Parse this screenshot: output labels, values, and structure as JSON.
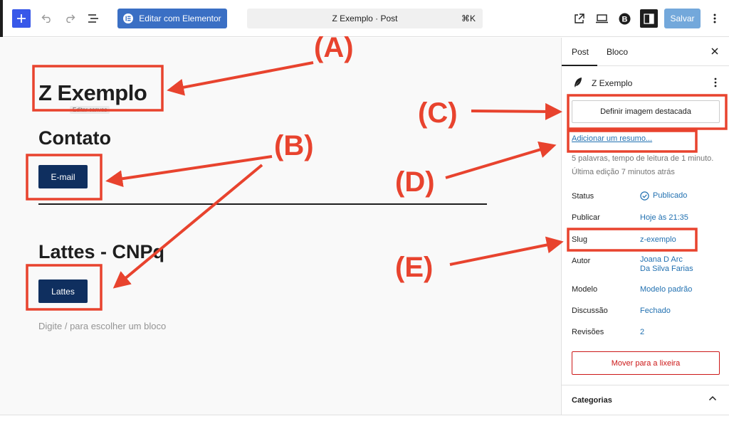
{
  "toolbar": {
    "elementor_label": "Editar com Elementor",
    "command_title": "Z Exemplo · Post",
    "command_shortcut": "⌘K",
    "save_label": "Salvar",
    "icons": [
      "plus-icon",
      "undo-icon",
      "redo-icon",
      "list-view-icon",
      "external-link-icon",
      "desktop-icon",
      "b-logo-icon",
      "sidebar-toggle-icon",
      "more-vertical-icon"
    ]
  },
  "canvas": {
    "post_title": "Z Exemplo",
    "tooltip": "Editar canvas",
    "heading_contato": "Contato",
    "email_button": "E-mail",
    "heading_lattes": "Lattes - CNPq",
    "lattes_button": "Lattes",
    "block_hint": "Digite / para escolher um bloco"
  },
  "sidebar": {
    "tab_post": "Post",
    "tab_block": "Bloco",
    "post_name": "Z Exemplo",
    "featured_image_button": "Definir imagem destacada",
    "excerpt_link": "Adicionar um resumo...",
    "meta_words": "5 palavras, tempo de leitura de 1 minuto.",
    "meta_edited": "Última edição 7 minutos atrás",
    "rows": [
      {
        "label": "Status",
        "value": "Publicado"
      },
      {
        "label": "Publicar",
        "value": "Hoje às 21:35"
      },
      {
        "label": "Slug",
        "value": "z-exemplo"
      },
      {
        "label": "Autor",
        "value": "Joana D Arc",
        "value2": "Da Silva Farias"
      },
      {
        "label": "Modelo",
        "value": "Modelo padrão"
      },
      {
        "label": "Discussão",
        "value": "Fechado"
      },
      {
        "label": "Revisões",
        "value": "2"
      }
    ],
    "trash_button": "Mover para a lixeira",
    "categories_label": "Categorias"
  },
  "annotations": {
    "color": "#e8432e",
    "labels": [
      "(A)",
      "(B)",
      "(C)",
      "(D)",
      "(E)"
    ]
  },
  "colors": {
    "accent": "#3858e9",
    "block_button": "#0f2f5f",
    "link": "#2271b1",
    "danger": "#cc1818"
  }
}
